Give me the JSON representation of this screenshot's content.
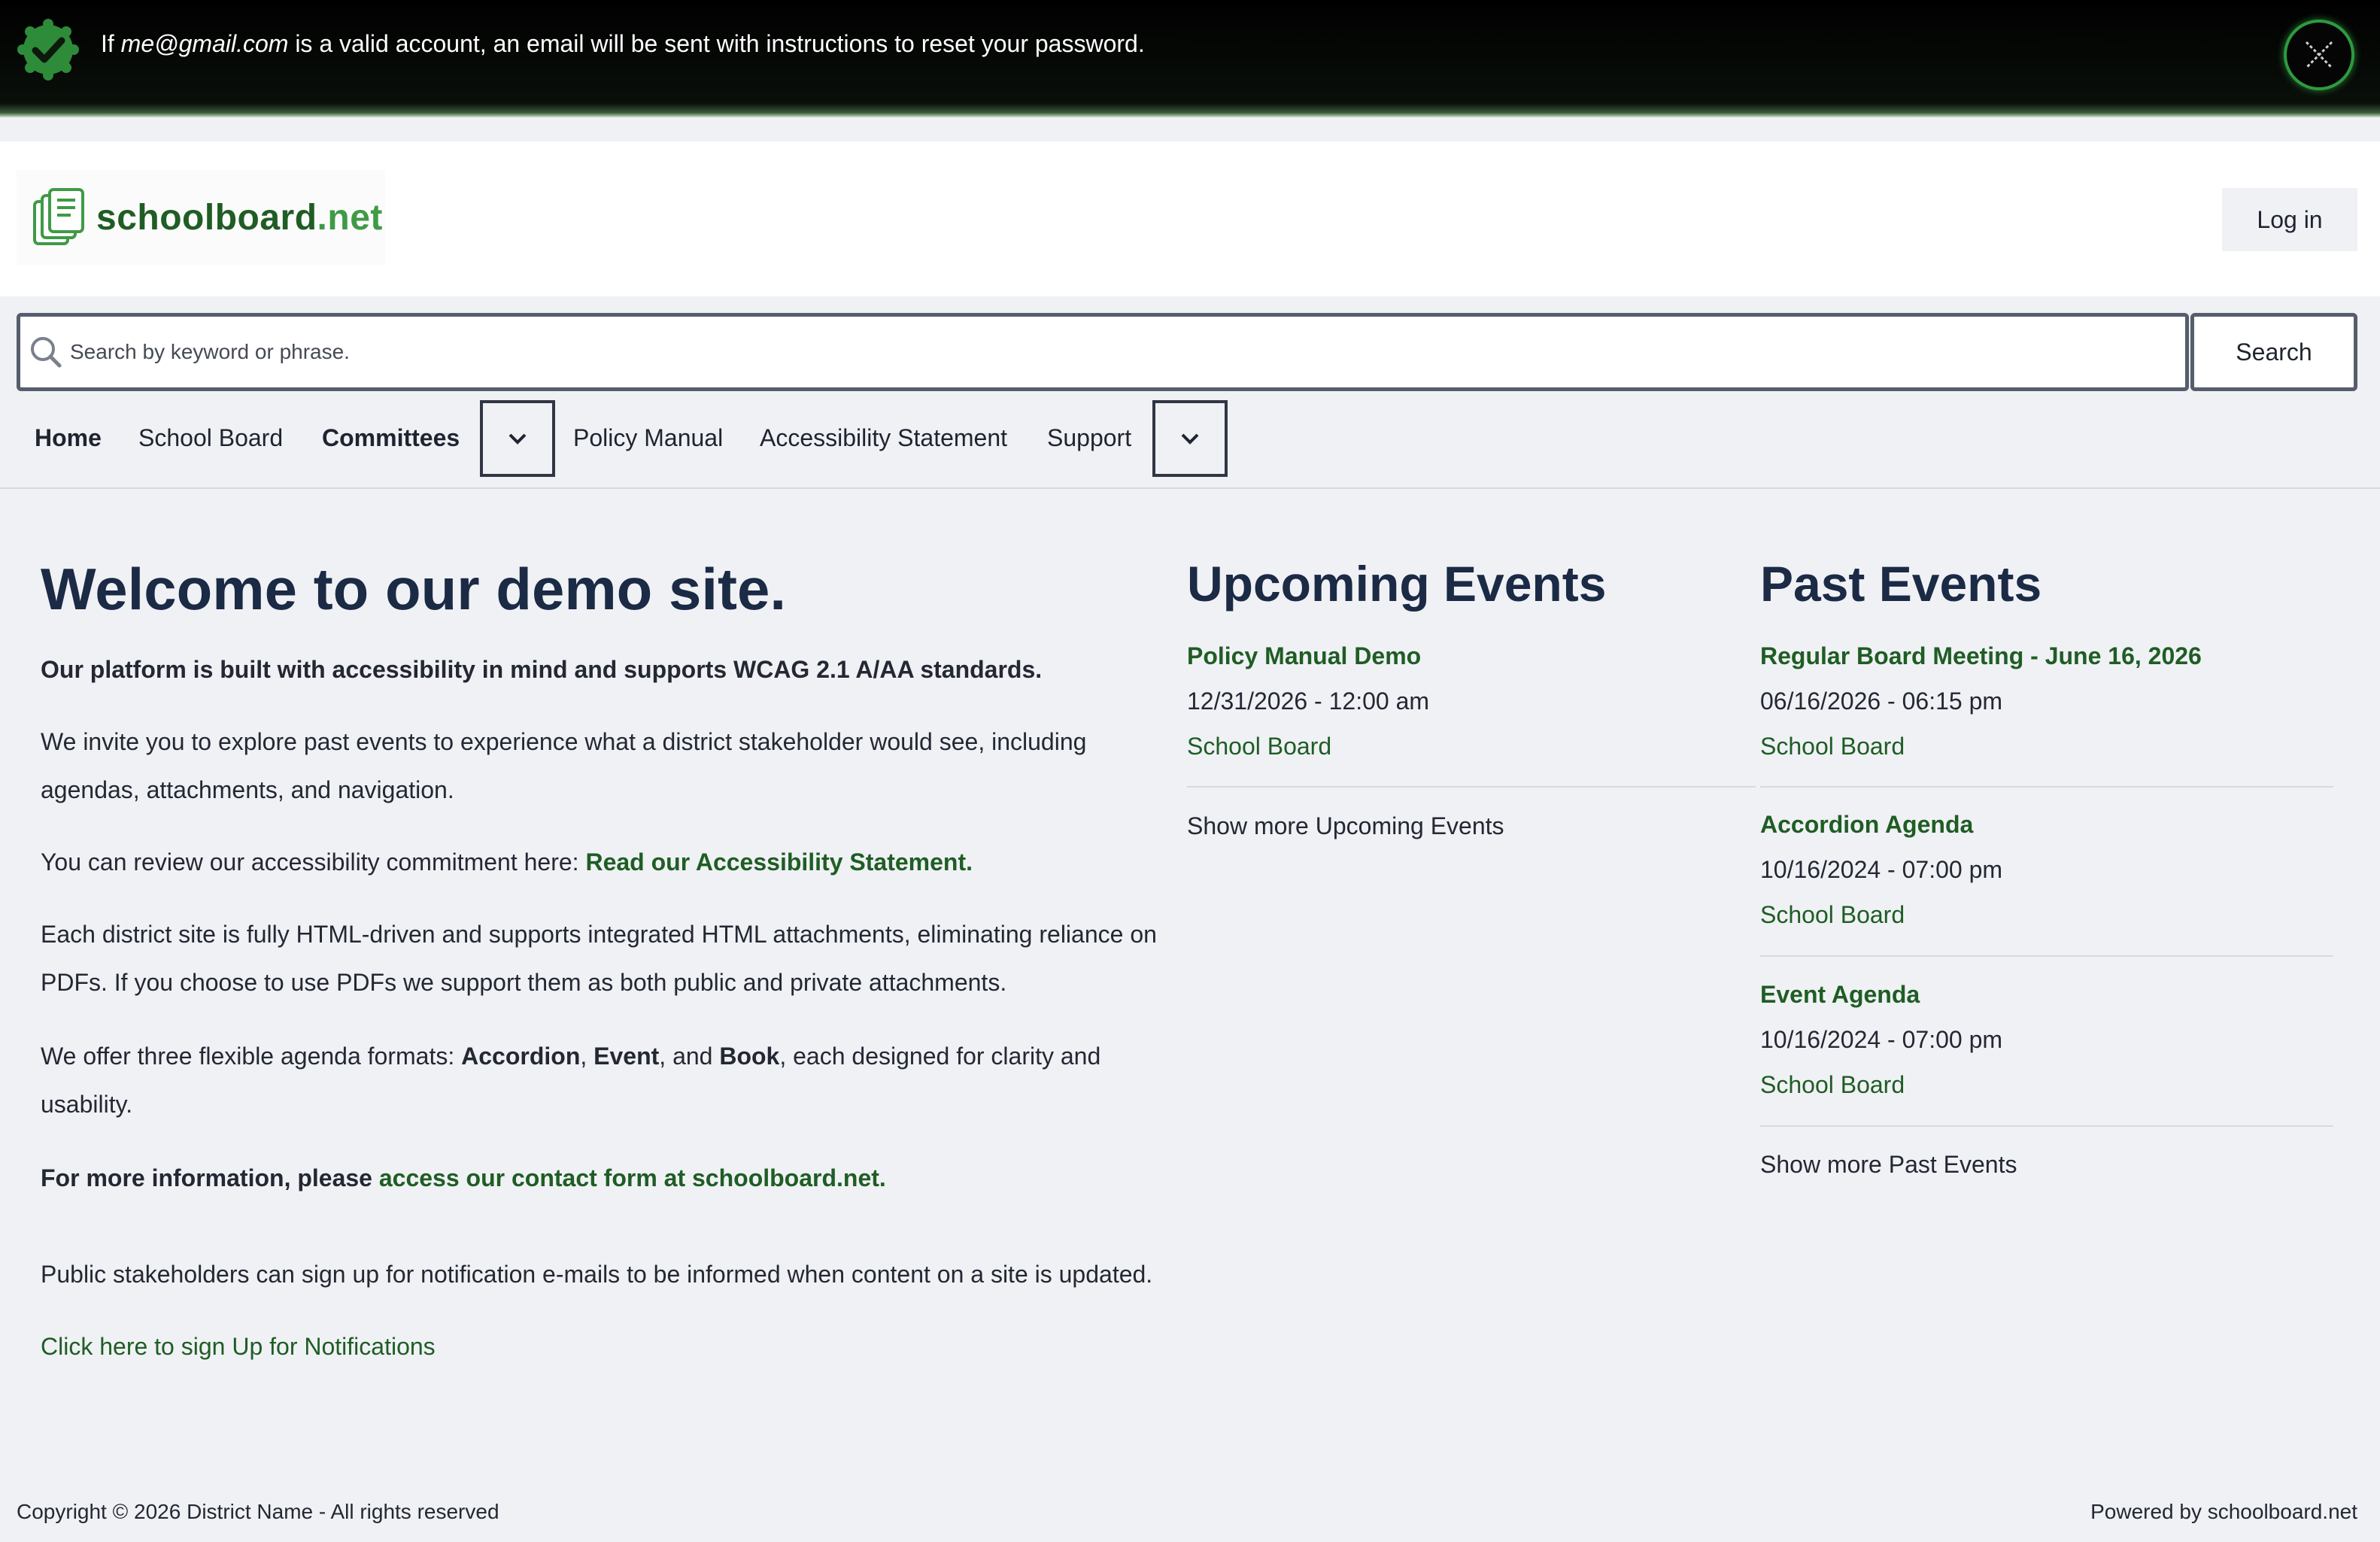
{
  "alert": {
    "prefix": "If",
    "email": "me@gmail.com",
    "message": "is a valid account, an email will be sent with instructions to reset your password."
  },
  "header": {
    "logo_main": "schoolboard",
    "logo_suffix": ".net",
    "login_label": "Log in"
  },
  "search": {
    "placeholder": "Search by keyword or phrase.",
    "button_label": "Search"
  },
  "nav": {
    "home": "Home",
    "school_board": "School Board",
    "committees": "Committees",
    "policy_manual": "Policy Manual",
    "accessibility": "Accessibility Statement",
    "support": "Support"
  },
  "main": {
    "title": "Welcome to our demo site.",
    "intro_bold": "Our platform is built with accessibility in mind and supports WCAG 2.1 A/AA standards.",
    "p_explore": "We invite you to explore past events to experience what a district stakeholder would see, including agendas, attachments, and navigation.",
    "p_review_prefix": "You can review our accessibility commitment here:",
    "p_review_link": "Read our Accessibility Statement.",
    "p_html": "Each district site is fully HTML-driven and supports integrated HTML attachments, eliminating reliance on PDFs. If you choose to use PDFs we support them as both public and private attachments.",
    "p_formats_prefix": "We offer three flexible agenda formats:",
    "p_formats_a": "Accordion",
    "p_formats_sep1": ",",
    "p_formats_b": "Event",
    "p_formats_sep2": ", and",
    "p_formats_c": "Book",
    "p_formats_suffix": ", each designed for clarity and usability.",
    "p_more_prefix": "For more information, please",
    "p_more_link": "access our contact form at schoolboard.net.",
    "p_public": "Public stakeholders can sign up for notification e-mails to be informed when content on a site is updated.",
    "signup_link": "Click here to sign Up for Notifications"
  },
  "upcoming": {
    "title": "Upcoming Events",
    "events": [
      {
        "title": "Policy Manual Demo",
        "date": "12/31/2026 - 12:00 am",
        "category": "School Board"
      }
    ],
    "more": "Show more Upcoming Events"
  },
  "past": {
    "title": "Past Events",
    "events": [
      {
        "title": "Regular Board Meeting - June 16, 2026",
        "date": "06/16/2026 - 06:15 pm",
        "category": "School Board"
      },
      {
        "title": "Accordion Agenda",
        "date": "10/16/2024 - 07:00 pm",
        "category": "School Board"
      },
      {
        "title": "Event Agenda",
        "date": "10/16/2024 - 07:00 pm",
        "category": "School Board"
      }
    ],
    "more": "Show more Past Events"
  },
  "footer": {
    "copyright": "Copyright © 2026 District Name - All rights reserved",
    "powered": "Powered by schoolboard.net"
  },
  "colors": {
    "accent_green": "#1f5d24",
    "heading_navy": "#1b2a45",
    "background": "#f0f1f5"
  }
}
